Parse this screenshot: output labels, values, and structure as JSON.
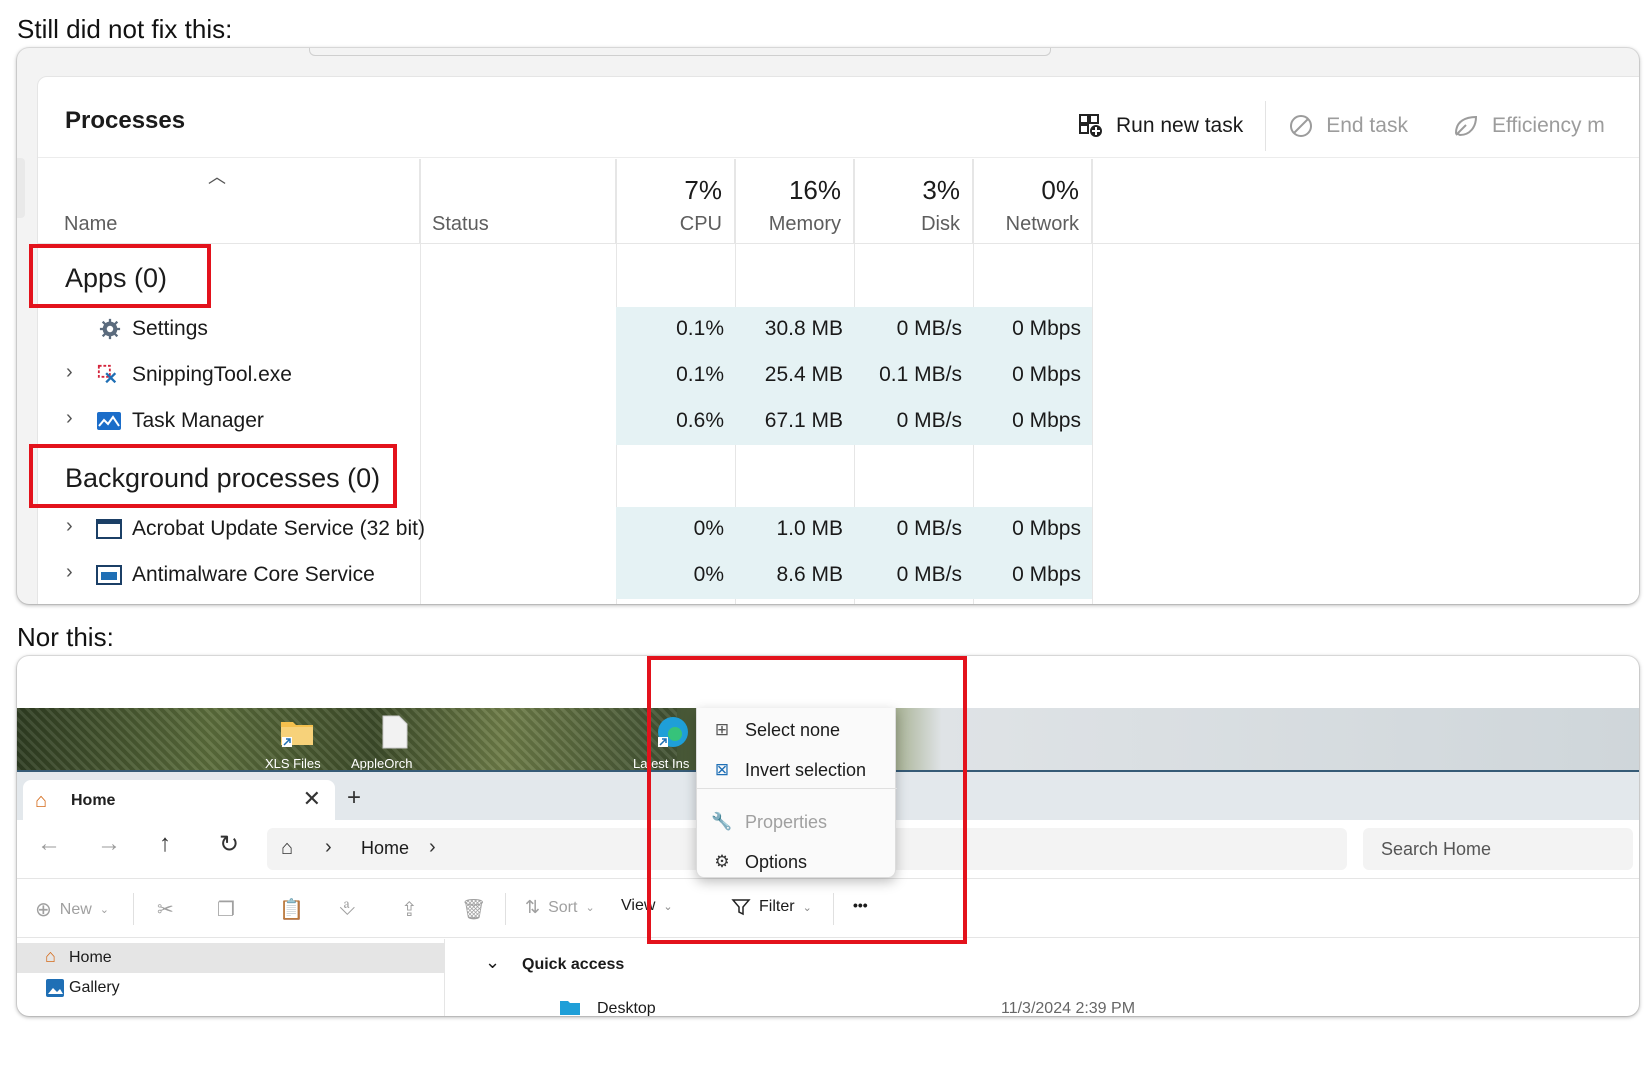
{
  "captions": {
    "first": "Still did not fix this:",
    "second": "Nor this:"
  },
  "task_manager": {
    "title": "Processes",
    "actions": {
      "run_new_task": "Run new task",
      "end_task": "End task",
      "efficiency": "Efficiency m"
    },
    "columns": {
      "name": "Name",
      "status": "Status",
      "cpu": {
        "pct": "7%",
        "label": "CPU"
      },
      "memory": {
        "pct": "16%",
        "label": "Memory"
      },
      "disk": {
        "pct": "3%",
        "label": "Disk"
      },
      "network": {
        "pct": "0%",
        "label": "Network"
      }
    },
    "groups": {
      "apps": "Apps (0)",
      "background": "Background processes (0)"
    },
    "apps": [
      {
        "name": "Settings",
        "cpu": "0.1%",
        "memory": "30.8 MB",
        "disk": "0 MB/s",
        "network": "0 Mbps",
        "icon": "gear-icon"
      },
      {
        "name": "SnippingTool.exe",
        "cpu": "0.1%",
        "memory": "25.4 MB",
        "disk": "0.1 MB/s",
        "network": "0 Mbps",
        "icon": "snipping-tool-icon"
      },
      {
        "name": "Task Manager",
        "cpu": "0.6%",
        "memory": "67.1 MB",
        "disk": "0 MB/s",
        "network": "0 Mbps",
        "icon": "task-manager-icon"
      }
    ],
    "background": [
      {
        "name": "Acrobat Update Service (32 bit)",
        "cpu": "0%",
        "memory": "1.0 MB",
        "disk": "0 MB/s",
        "network": "0 Mbps",
        "icon": "window-icon"
      },
      {
        "name": "Antimalware Core Service",
        "cpu": "0%",
        "memory": "8.6 MB",
        "disk": "0 MB/s",
        "network": "0 Mbps",
        "icon": "service-icon"
      }
    ],
    "highlight_color": "#e3121c"
  },
  "explorer": {
    "desktop_labels": [
      "XLS Files",
      "AppleOrch",
      "Latest Ins"
    ],
    "tab": {
      "label": "Home",
      "close": "✕",
      "add": "+"
    },
    "address": {
      "crumb": "Home",
      "search_placeholder": "Search Home"
    },
    "toolbar": {
      "new": "New",
      "sort": "Sort",
      "view": "View",
      "filter": "Filter",
      "more": "•••"
    },
    "menu": {
      "select_none": "Select none",
      "invert_selection": "Invert selection",
      "properties": "Properties",
      "options": "Options"
    },
    "nav": {
      "home": "Home",
      "gallery": "Gallery"
    },
    "content": {
      "quick_access": "Quick access",
      "file_name": "Desktop",
      "file_date": "11/3/2024 2:39 PM"
    }
  }
}
